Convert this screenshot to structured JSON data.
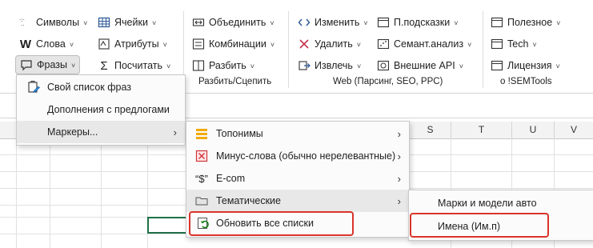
{
  "ribbon": {
    "col1": {
      "symbols": "Символы",
      "words": "Слова",
      "phrases": "Фразы"
    },
    "col2": {
      "cells": "Ячейки",
      "attributes": "Атрибуты",
      "count": "Посчитать"
    },
    "group_join": {
      "merge": "Объединить",
      "combinations": "Комбинации",
      "split": "Разбить",
      "label": "Разбить/Сцепить"
    },
    "group_web": {
      "change": "Изменить",
      "delete": "Удалить",
      "extract": "Извлечь",
      "hints": "П.подсказки",
      "semantic": "Семант.анализ",
      "external_api": "Внешние API",
      "label": "Web (Парсинг, SEO, PPC)"
    },
    "group_about": {
      "useful": "Полезное",
      "tech": "Tech",
      "license": "Лицензия",
      "label": "о !SEMTools"
    }
  },
  "columns": [
    "S",
    "T",
    "U",
    "V"
  ],
  "phrases_menu": {
    "items": [
      {
        "label": "Свой список фраз",
        "icon": "edit-list-icon"
      },
      {
        "label": "Дополнения с предлогами",
        "icon": ""
      },
      {
        "label": "Маркеры...",
        "icon": "",
        "submenu": true
      }
    ]
  },
  "markers_menu": {
    "items": [
      {
        "label": "Топонимы",
        "icon": "stack-icon",
        "submenu": true
      },
      {
        "label": "Минус-слова (обычно нерелевантные)",
        "icon": "x-box-icon",
        "submenu": true
      },
      {
        "label": "E-com",
        "icon": "dollar-icon",
        "submenu": true
      },
      {
        "label": "Тематические",
        "icon": "folder-icon",
        "submenu": true
      },
      {
        "label": "Обновить все списки",
        "icon": "refresh-icon",
        "submenu": false
      }
    ]
  },
  "thematic_menu": {
    "items": [
      {
        "label": "Марки и модели авто"
      },
      {
        "label": "Имена (Им.п)"
      }
    ]
  },
  "colors": {
    "highlight_box": "#d9342b",
    "excel_green": "#1e7145",
    "menu_hover": "#e8e8e8"
  }
}
